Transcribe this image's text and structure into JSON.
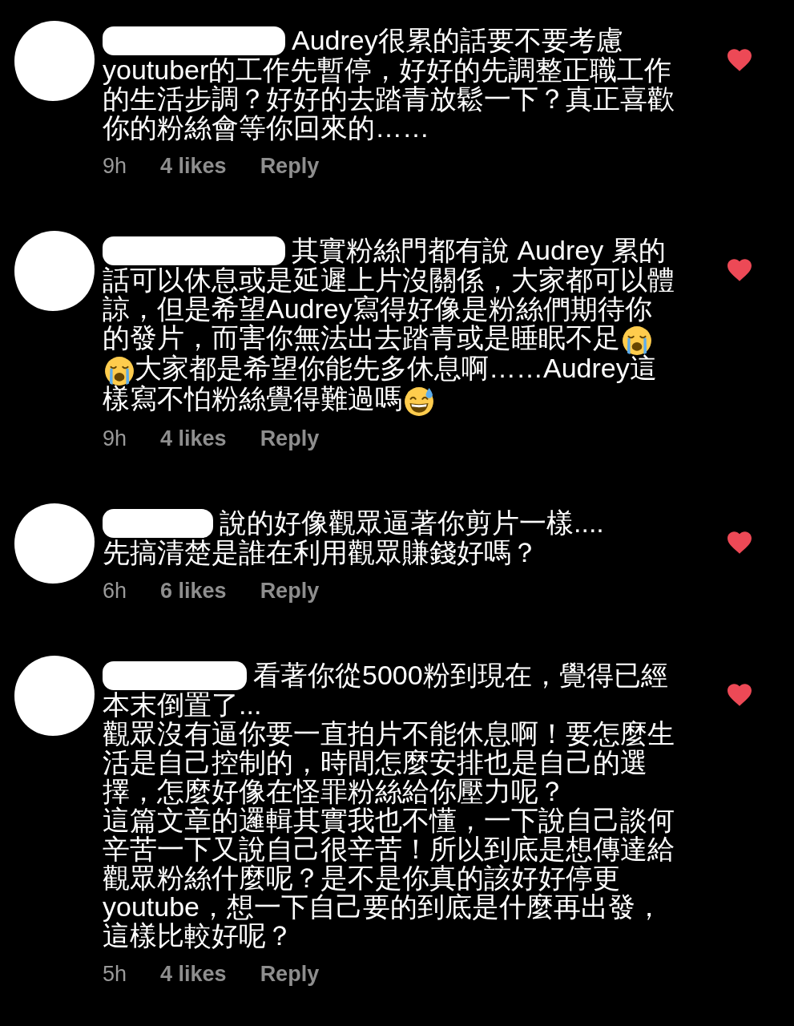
{
  "comments": [
    {
      "redacted": true,
      "liked": true,
      "body": [
        {
          "parts": [
            {
              "kind": "text",
              "text": "Audrey很累的話要不要考慮youtuber的工作先暫停，好好的先調整正職工作的生活步調？好好的去踏青放鬆一下？真正喜歡你的粉絲會等你回來的……"
            }
          ]
        }
      ],
      "time": "9h",
      "likes": "4 likes",
      "reply": "Reply"
    },
    {
      "redacted": true,
      "liked": true,
      "body": [
        {
          "parts": [
            {
              "kind": "text",
              "text": "其實粉絲門都有說 Audrey 累的話可以休息或是延遲上片沒關係，大家都可以體諒，但是希望Audrey寫得好像是粉絲們期待你"
            },
            {
              "kind": "text",
              "text": "的發片，而害你無法出去踏青或是睡眠不足"
            },
            {
              "kind": "crying"
            },
            {
              "kind": "crying"
            },
            {
              "kind": "text",
              "text": "大家都是希望你能先多休息啊……Audrey這"
            },
            {
              "kind": "text",
              "text": "樣寫不怕粉絲覺得難過嗎"
            },
            {
              "kind": "sweat"
            }
          ]
        }
      ],
      "time": "9h",
      "likes": "4 likes",
      "reply": "Reply"
    },
    {
      "redacted": true,
      "liked": true,
      "body": [
        {
          "parts": [
            {
              "kind": "text",
              "text": "說的好像觀眾逼著你剪片一樣...."
            }
          ]
        },
        {
          "parts": [
            {
              "kind": "text",
              "text": "先搞清楚是誰在利用觀眾賺錢好嗎？"
            }
          ]
        }
      ],
      "time": "6h",
      "likes": "6 likes",
      "reply": "Reply"
    },
    {
      "redacted": true,
      "liked": true,
      "body": [
        {
          "parts": [
            {
              "kind": "text",
              "text": "看著你從5000粉到現在，覺得已經本末倒置了..."
            }
          ]
        },
        {
          "parts": [
            {
              "kind": "text",
              "text": "觀眾沒有逼你要一直拍片不能休息啊！要怎麼生活是自己控制的，時間怎麼安排也是自己的選擇，怎麼好像在怪罪粉絲給你壓力呢？"
            }
          ]
        },
        {
          "parts": [
            {
              "kind": "text",
              "text": "這篇文章的邏輯其實我也不懂，一下說自己談何辛苦一下又說自己很辛苦！所以到底是想傳達給觀眾粉絲什麼呢？是不是你真的該好好停更youtube，想一下自己要的到底是什麼再出發，這樣比較好呢？"
            }
          ]
        }
      ],
      "time": "5h",
      "likes": "4 likes",
      "reply": "Reply"
    }
  ]
}
